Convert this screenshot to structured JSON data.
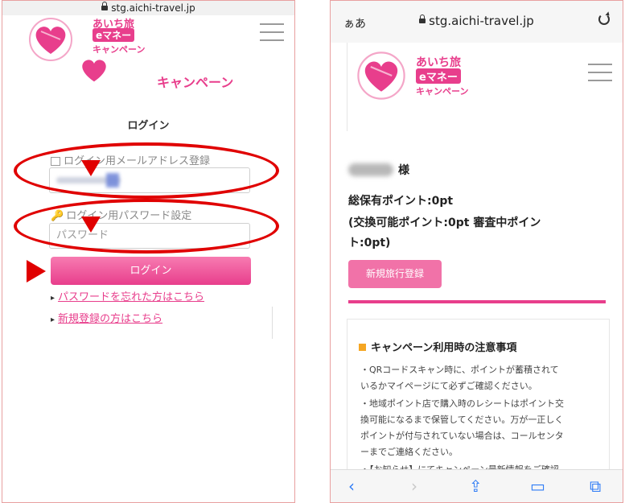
{
  "left": {
    "url": "stg.aichi-travel.jp",
    "logo": {
      "line1": "あいち旅",
      "emoney": "eマネー",
      "line3": "キャンペーン"
    },
    "title": "ログイン",
    "email_label": "ログイン用メールアドレス登録",
    "password_label": "ログイン用パスワード設定",
    "password_placeholder": "パスワード",
    "login_button": "ログイン",
    "forgot_link": "パスワードを忘れた方はこちら",
    "register_link": "新規登録の方はこちら"
  },
  "right": {
    "browser_aa": "ぁあ",
    "url": "stg.aichi-travel.jp",
    "logo": {
      "line1": "あいち旅",
      "emoney": "eマネー",
      "line3": "キャンペーン"
    },
    "sama": "様",
    "points_total": "総保有ポイント:0pt",
    "points_detail_1": "(交換可能ポイント:0pt 審査中ポイン",
    "points_detail_2": "ト:0pt)",
    "new_trip_button": "新規旅行登録",
    "notice_title": "キャンペーン利用時の注意事項",
    "notice_lines": [
      "・QRコードスキャン時に、ポイントが蓄積されて",
      "いるかマイページにて必ずご確認ください。",
      "・地域ポイント店で購入時のレシートはポイント交",
      "換可能になるまで保管してください。万が一正しく",
      "ポイントが付与されていない場合は、コールセンタ",
      "ーまでご連絡ください。",
      "・【お知らせ】にてキャンペーン最新情報をご確認"
    ]
  },
  "colors": {
    "brand": "#e83e8c",
    "annotation": "#e00000",
    "link": "#2f7cf6"
  }
}
